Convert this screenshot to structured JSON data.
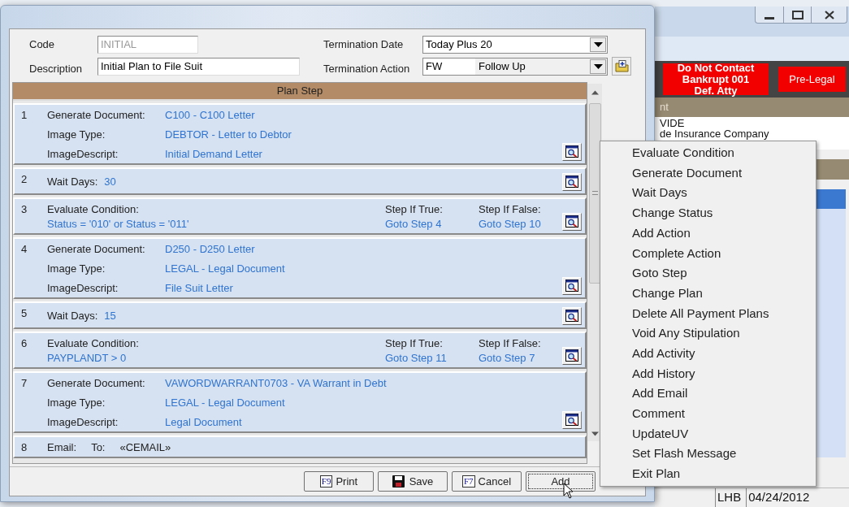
{
  "dialog": {
    "code_label": "Code",
    "code_value": "INITIAL",
    "description_label": "Description",
    "description_value": "Initial Plan to File Suit",
    "termination_date_label": "Termination Date",
    "termination_date_value": "Today Plus 20",
    "termination_action_label": "Termination Action",
    "termination_action_code": "FW",
    "termination_action_value": "Follow Up"
  },
  "plan_steps": {
    "header": "Plan Step",
    "steps": [
      {
        "number": "1",
        "kind": "document",
        "fields": [
          {
            "label": "Generate Document:",
            "value": "C100 - C100 Letter"
          },
          {
            "label": "Image Type:",
            "value": "DEBTOR - Letter to Debtor"
          },
          {
            "label": "ImageDescript:",
            "value": "Initial Demand Letter"
          }
        ]
      },
      {
        "number": "2",
        "kind": "wait",
        "label": "Wait Days:",
        "value": "30"
      },
      {
        "number": "3",
        "kind": "condition",
        "label": "Evaluate Condition:",
        "value": "Status = '010' or Status = '011'",
        "true_label": "Step If True:",
        "true_value": "Goto Step 4",
        "false_label": "Step If False:",
        "false_value": "Goto Step 10"
      },
      {
        "number": "4",
        "kind": "document",
        "fields": [
          {
            "label": "Generate Document:",
            "value": "D250 - D250 Letter"
          },
          {
            "label": "Image Type:",
            "value": "LEGAL - Legal Document"
          },
          {
            "label": "ImageDescript:",
            "value": "File Suit Letter"
          }
        ]
      },
      {
        "number": "5",
        "kind": "wait",
        "label": "Wait Days:",
        "value": "15"
      },
      {
        "number": "6",
        "kind": "condition",
        "label": "Evaluate Condition:",
        "value": "PAYPLANDT > 0",
        "true_label": "Step If True:",
        "true_value": "Goto Step 11",
        "false_label": "Step If False:",
        "false_value": "Goto Step 7"
      },
      {
        "number": "7",
        "kind": "document",
        "fields": [
          {
            "label": "Generate Document:",
            "value": "VAWORDWARRANT0703 - VA Warrant in Debt"
          },
          {
            "label": "Image Type:",
            "value": "LEGAL - Legal Document"
          },
          {
            "label": "ImageDescript:",
            "value": "Legal Document"
          }
        ]
      },
      {
        "number": "8",
        "kind": "email",
        "label": "Email:",
        "to_label": "To:",
        "value": "«CEMAIL»"
      }
    ]
  },
  "buttons": [
    {
      "kind": "fkey",
      "key": "F9",
      "label": "Print",
      "focused": false
    },
    {
      "kind": "save",
      "label": "Save",
      "focused": false
    },
    {
      "kind": "fkey",
      "key": "F7",
      "label": "Cancel",
      "focused": false
    },
    {
      "kind": "plain",
      "label": "Add",
      "focused": true
    }
  ],
  "background_window": {
    "flags": [
      {
        "lines": [
          "Do Not Contact",
          "Bankrupt 001",
          "Def. Atty"
        ]
      },
      {
        "lines": [
          "Pre-Legal"
        ]
      }
    ],
    "header": "nt",
    "list": [
      "VIDE",
      "de Insurance Company"
    ],
    "status": [
      "LHB",
      "04/24/2012"
    ]
  },
  "menu": {
    "items": [
      "Evaluate Condition",
      "Generate Document",
      "Wait Days",
      "Change Status",
      "Add Action",
      "Complete Action",
      "Goto Step",
      "Change Plan",
      "Delete All Payment Plans",
      "Void Any Stipulation",
      "Add Activity",
      "Add History",
      "Add Email",
      "Comment",
      "UpdateUV",
      "Set Flash Message",
      "Exit Plan"
    ]
  }
}
